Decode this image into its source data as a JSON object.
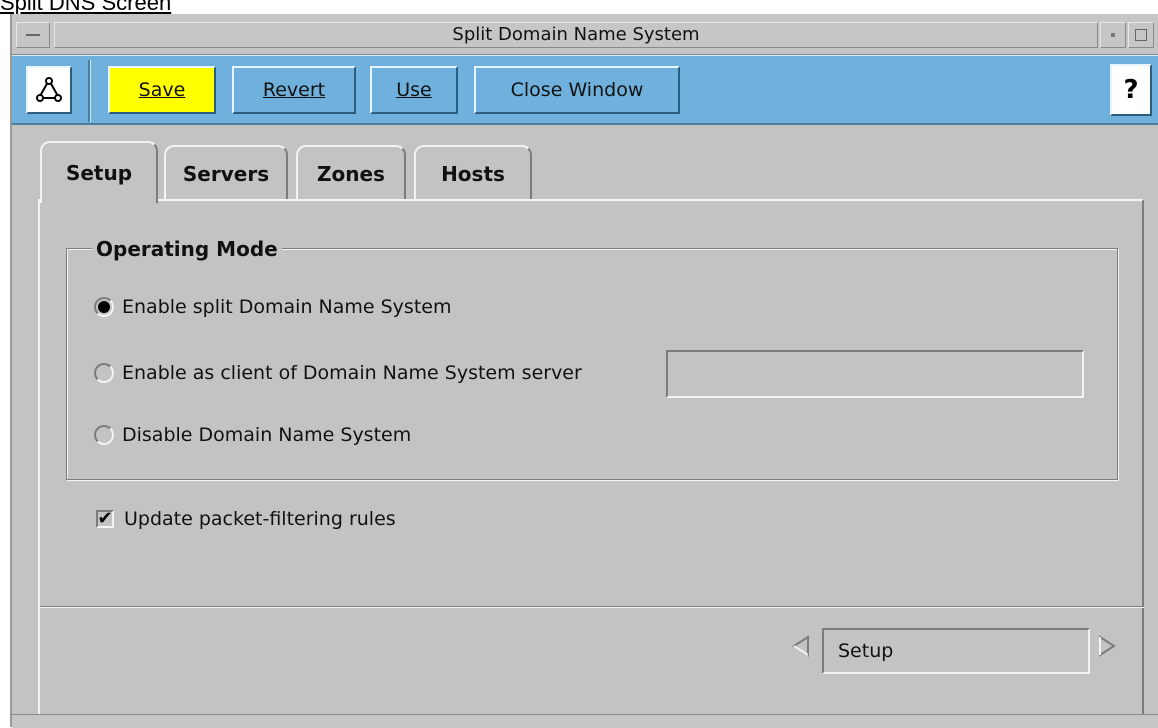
{
  "page_caption": "Split DNS Screen",
  "window": {
    "title": "Split Domain Name System"
  },
  "toolbar": {
    "save_label": "Save",
    "revert_label": "Revert",
    "use_label": "Use",
    "close_label": "Close Window",
    "help_label": "?",
    "save_color": "#ffff00",
    "bar_color": "#6fb1dc"
  },
  "tabs": [
    {
      "label": "Setup",
      "active": true
    },
    {
      "label": "Servers",
      "active": false
    },
    {
      "label": "Zones",
      "active": false
    },
    {
      "label": "Hosts",
      "active": false
    }
  ],
  "operating_mode": {
    "legend": "Operating Mode",
    "options": [
      {
        "label": "Enable split Domain Name System",
        "selected": true
      },
      {
        "label": "Enable as client of Domain Name System server",
        "selected": false
      },
      {
        "label": "Disable Domain Name System",
        "selected": false
      }
    ],
    "server_field_value": ""
  },
  "update_rules": {
    "label": "Update packet-filtering rules",
    "checked": true
  },
  "navigator": {
    "current": "Setup"
  }
}
